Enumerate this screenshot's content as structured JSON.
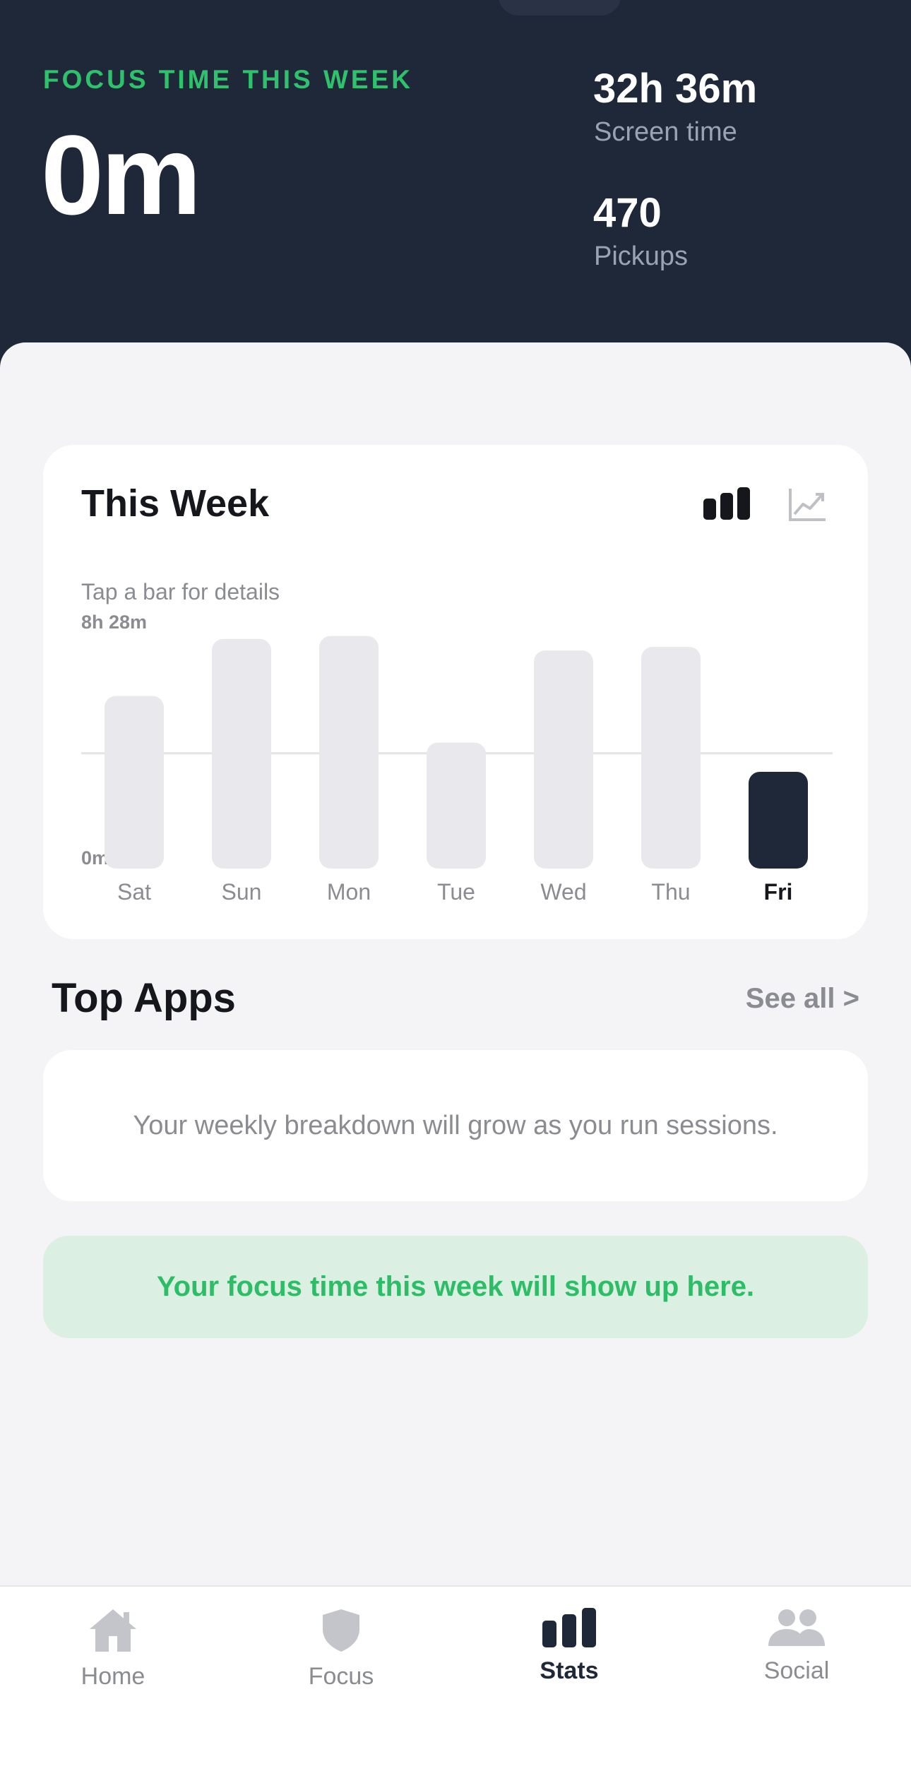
{
  "header": {
    "focus_label": "FOCUS TIME THIS WEEK",
    "focus_value": "0m",
    "screen_time_value": "32h 36m",
    "screen_time_label": "Screen time",
    "pickups_value": "470",
    "pickups_label": "Pickups"
  },
  "week_card": {
    "title": "This Week",
    "hint": "Tap a bar for details",
    "icons": [
      "bar-chart-icon",
      "trend-chart-icon"
    ]
  },
  "chart_data": {
    "type": "bar",
    "categories": [
      "Sat",
      "Sun",
      "Mon",
      "Tue",
      "Wed",
      "Thu",
      "Fri"
    ],
    "values": [
      6.33,
      8.42,
      8.53,
      4.62,
      8.0,
      8.13,
      3.55
    ],
    "selected": "Fri",
    "y_top_label": "8h 28m",
    "y_bottom_label": "0m",
    "ylim": [
      0,
      8.47
    ],
    "reference_line": 4.23,
    "colors": {
      "bar": "#e8e8ed",
      "selected": "#1f2839"
    }
  },
  "top_apps": {
    "title": "Top Apps",
    "see_all": "See all >",
    "empty_message": "Your weekly breakdown will grow as you run sessions."
  },
  "focus_banner": {
    "message": "Your focus time this week will show up here."
  },
  "tabbar": {
    "tabs": [
      {
        "label": "Home",
        "icon": "home-icon"
      },
      {
        "label": "Focus",
        "icon": "shield-icon"
      },
      {
        "label": "Stats",
        "icon": "stats-icon",
        "active": true
      },
      {
        "label": "Social",
        "icon": "people-icon"
      }
    ]
  },
  "colors": {
    "header_bg": "#1f2839",
    "accent_green": "#2dc26b",
    "sheet_bg": "#f4f4f6"
  }
}
